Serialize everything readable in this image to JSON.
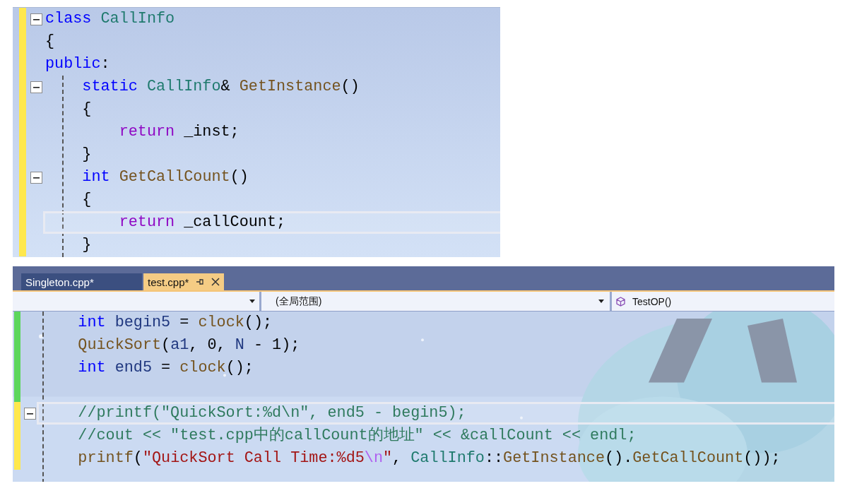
{
  "top_snippet": {
    "lines": [
      {
        "color": "#ffe84d",
        "fold": true,
        "current": false,
        "tokens": [
          {
            "kind": "keyword",
            "text": "class "
          },
          {
            "kind": "type",
            "text": "CallInfo"
          }
        ]
      },
      {
        "color": "#ffe84d",
        "fold": false,
        "current": false,
        "tokens": [
          {
            "kind": "plain",
            "text": "{"
          }
        ]
      },
      {
        "color": "#ffe84d",
        "fold": false,
        "current": false,
        "tokens": [
          {
            "kind": "keyword",
            "text": "public"
          },
          {
            "kind": "plain",
            "text": ":"
          }
        ]
      },
      {
        "color": "#ffe84d",
        "fold": true,
        "current": false,
        "tokens": [
          {
            "kind": "keyword",
            "text": "    static "
          },
          {
            "kind": "type",
            "text": "CallInfo"
          },
          {
            "kind": "plain",
            "text": "& "
          },
          {
            "kind": "function",
            "text": "GetInstance"
          },
          {
            "kind": "plain",
            "text": "()"
          }
        ]
      },
      {
        "color": "#ffe84d",
        "fold": false,
        "current": false,
        "tokens": [
          {
            "kind": "plain",
            "text": "    {"
          }
        ]
      },
      {
        "color": "#ffe84d",
        "fold": false,
        "current": false,
        "tokens": [
          {
            "kind": "control",
            "text": "        return"
          },
          {
            "kind": "plain",
            "text": " _inst;"
          }
        ]
      },
      {
        "color": "#ffe84d",
        "fold": false,
        "current": false,
        "tokens": [
          {
            "kind": "plain",
            "text": "    }"
          }
        ]
      },
      {
        "color": "#ffe84d",
        "fold": true,
        "current": false,
        "tokens": [
          {
            "kind": "keyword",
            "text": "    int "
          },
          {
            "kind": "function",
            "text": "GetCallCount"
          },
          {
            "kind": "plain",
            "text": "()"
          }
        ]
      },
      {
        "color": "#ffe84d",
        "fold": false,
        "current": false,
        "tokens": [
          {
            "kind": "plain",
            "text": "    {"
          }
        ]
      },
      {
        "color": "#ffe84d",
        "fold": false,
        "current": true,
        "tokens": [
          {
            "kind": "control",
            "text": "        return"
          },
          {
            "kind": "plain",
            "text": " _callCount;"
          }
        ]
      },
      {
        "color": "#ffe84d",
        "fold": false,
        "current": false,
        "tokens": [
          {
            "kind": "plain",
            "text": "    }"
          }
        ]
      }
    ]
  },
  "editor": {
    "tabs": [
      {
        "label": "Singleton.cpp*",
        "selected": false
      },
      {
        "label": "test.cpp*",
        "selected": true
      }
    ],
    "nav": {
      "scope": "(全局范围)",
      "member": "TestOP()"
    },
    "lines": [
      {
        "color": "#5cd65c",
        "fold": false,
        "current": false,
        "tokens": [
          {
            "kind": "keyword",
            "text": "    int "
          },
          {
            "kind": "variable",
            "text": "begin5"
          },
          {
            "kind": "plain",
            "text": " = "
          },
          {
            "kind": "function",
            "text": "clock"
          },
          {
            "kind": "plain",
            "text": "();"
          }
        ]
      },
      {
        "color": "#5cd65c",
        "fold": false,
        "current": false,
        "tokens": [
          {
            "kind": "function",
            "text": "    QuickSort"
          },
          {
            "kind": "plain",
            "text": "("
          },
          {
            "kind": "variable",
            "text": "a1"
          },
          {
            "kind": "plain",
            "text": ", 0, "
          },
          {
            "kind": "variable",
            "text": "N"
          },
          {
            "kind": "plain",
            "text": " - 1);"
          }
        ]
      },
      {
        "color": "#5cd65c",
        "fold": false,
        "current": false,
        "tokens": [
          {
            "kind": "keyword",
            "text": "    int "
          },
          {
            "kind": "variable",
            "text": "end5"
          },
          {
            "kind": "plain",
            "text": " = "
          },
          {
            "kind": "function",
            "text": "clock"
          },
          {
            "kind": "plain",
            "text": "();"
          }
        ]
      },
      {
        "color": "#5cd65c",
        "fold": false,
        "current": false
      },
      {
        "color": "#ffe84d",
        "fold": true,
        "current": true,
        "tokens": [
          {
            "kind": "comment",
            "text": "    //printf(\"QuickSort:%d\\n\", end5 - begin5);"
          }
        ]
      },
      {
        "color": "#ffe84d",
        "fold": false,
        "current": false,
        "tokens": [
          {
            "kind": "comment",
            "text": "    //cout << \"test.cpp中的callCount的地址\" << &callCount << endl;"
          }
        ]
      },
      {
        "color": "#ffe84d",
        "fold": false,
        "current": false,
        "tokens": [
          {
            "kind": "function",
            "text": "    printf"
          },
          {
            "kind": "plain",
            "text": "("
          },
          {
            "kind": "string",
            "text": "\"QuickSort Call Time:%d5"
          },
          {
            "kind": "escape",
            "text": "\\n"
          },
          {
            "kind": "string",
            "text": "\""
          },
          {
            "kind": "plain",
            "text": ", "
          },
          {
            "kind": "type",
            "text": "CallInfo"
          },
          {
            "kind": "plain",
            "text": "::"
          },
          {
            "kind": "function",
            "text": "GetInstance"
          },
          {
            "kind": "plain",
            "text": "()."
          },
          {
            "kind": "function",
            "text": "GetCallCount"
          },
          {
            "kind": "plain",
            "text": "());"
          }
        ]
      }
    ]
  }
}
